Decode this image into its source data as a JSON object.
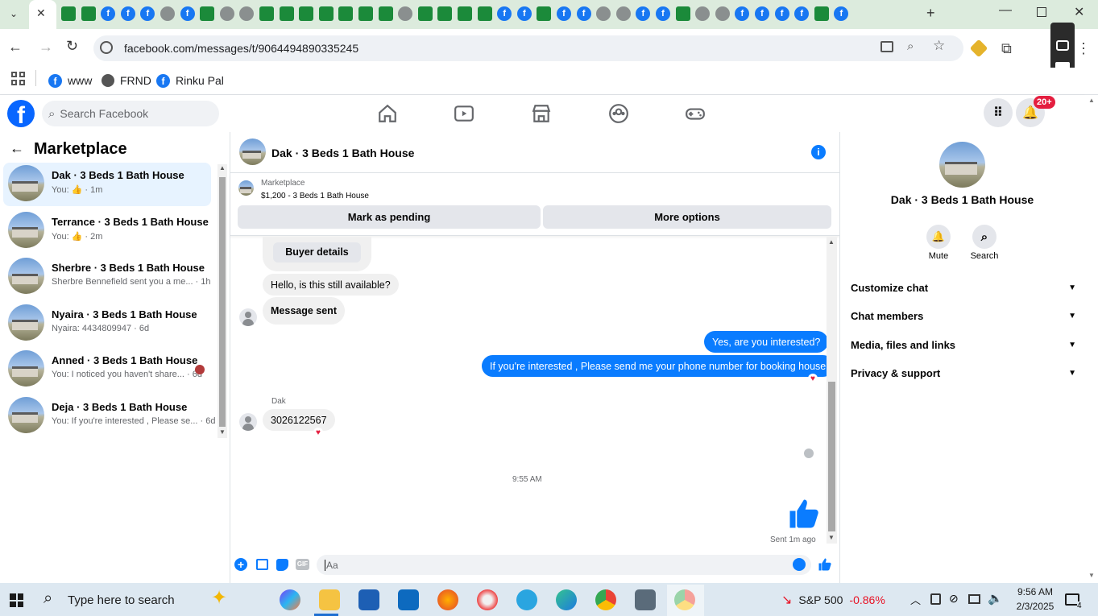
{
  "browser": {
    "url": "facebook.com/messages/t/9064494890335245",
    "bookmarks": [
      {
        "label": "www"
      },
      {
        "label": "FRND"
      },
      {
        "label": "Rinku Pal"
      }
    ]
  },
  "facebook": {
    "search_placeholder": "Search Facebook",
    "notification_badge": "20+"
  },
  "left": {
    "title": "Marketplace",
    "conversations": [
      {
        "name": "Dak · 3 Beds 1 Bath House",
        "sub": "You: 👍 · 1m",
        "selected": true
      },
      {
        "name": "Terrance · 3 Beds 1 Bath House",
        "sub": "You: 👍 · 2m"
      },
      {
        "name": "Sherbre · 3 Beds 1 Bath House",
        "sub": "Sherbre Bennefield sent you a me... · 1h"
      },
      {
        "name": "Nyaira · 3 Beds 1 Bath House",
        "sub": "Nyaira: 4434809947 · 6d"
      },
      {
        "name": "Anned · 3 Beds 1 Bath House",
        "sub": "You: I noticed you haven't share... · 6d"
      },
      {
        "name": "Deja · 3 Beds 1 Bath House",
        "sub": "You: If you're interested , Please se... · 6d"
      }
    ]
  },
  "chat": {
    "title": "Dak · 3 Beds 1 Bath House",
    "listing_source": "Marketplace",
    "listing_title": "$1,200 - 3 Beds 1 Bath House",
    "mark_pending": "Mark as pending",
    "more_options": "More options",
    "buyer_details": "Buyer details",
    "msg1": "Hello, is this still available?",
    "msg2": "Message sent",
    "out1": "Yes, are you interested?",
    "out2": "If you're interested , Please send me your phone number for booking house",
    "sender": "Dak",
    "msg3": "3026122567",
    "timestamp": "9:55 AM",
    "sent_status": "Sent 1m ago",
    "input_placeholder": "Aa",
    "gif_label": "GIF"
  },
  "details": {
    "title": "Dak · 3 Beds 1 Bath House",
    "mute": "Mute",
    "search": "Search",
    "sections": [
      "Customize chat",
      "Chat members",
      "Media, files and links",
      "Privacy & support"
    ]
  },
  "taskbar": {
    "search_placeholder": "Type here to search",
    "stock_name": "S&P 500",
    "stock_change": "-0.86%",
    "time": "9:56 AM",
    "date": "2/3/2025",
    "notif_count": "4"
  },
  "colors": {
    "fb_blue": "#1877f2",
    "bubble_out": "#0a7cff",
    "stock_down": "#e81123"
  }
}
